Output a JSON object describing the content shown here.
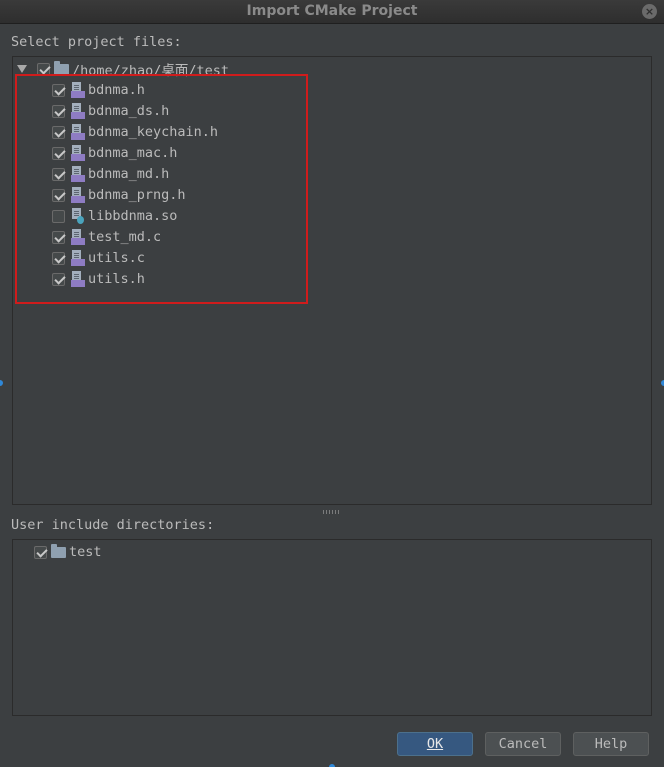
{
  "window": {
    "title": "Import CMake Project",
    "close_glyph": "×"
  },
  "files_section": {
    "label": "Select project files:",
    "root": {
      "path": "/home/zhao/桌面/test",
      "checked": true
    },
    "items": [
      {
        "name": "bdnma.h",
        "checked": true,
        "icon": "c-header-icon"
      },
      {
        "name": "bdnma_ds.h",
        "checked": true,
        "icon": "c-header-icon"
      },
      {
        "name": "bdnma_keychain.h",
        "checked": true,
        "icon": "c-header-icon"
      },
      {
        "name": "bdnma_mac.h",
        "checked": true,
        "icon": "c-header-icon"
      },
      {
        "name": "bdnma_md.h",
        "checked": true,
        "icon": "c-header-icon"
      },
      {
        "name": "bdnma_prng.h",
        "checked": true,
        "icon": "c-header-icon"
      },
      {
        "name": "libbdnma.so",
        "checked": false,
        "icon": "library-file-icon"
      },
      {
        "name": "test_md.c",
        "checked": true,
        "icon": "c-source-icon"
      },
      {
        "name": "utils.c",
        "checked": true,
        "icon": "c-source-icon"
      },
      {
        "name": "utils.h",
        "checked": true,
        "icon": "c-header-icon"
      }
    ]
  },
  "include_section": {
    "label": "User include directories:",
    "items": [
      {
        "name": "test",
        "checked": true
      }
    ]
  },
  "buttons": {
    "ok": "OK",
    "cancel": "Cancel",
    "help": "Help"
  },
  "colors": {
    "highlight": "#d01c1c",
    "primary_button": "#365880",
    "background": "#3c3f41"
  }
}
